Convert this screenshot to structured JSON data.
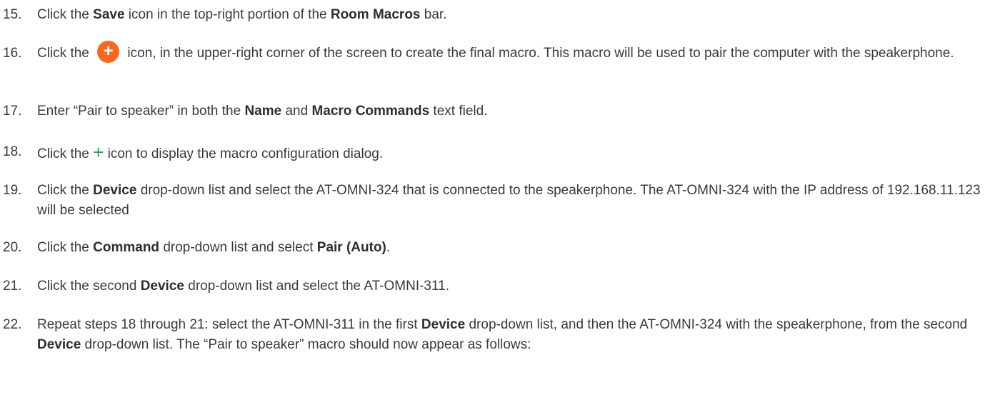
{
  "steps": [
    {
      "num": "15.",
      "parts": [
        "Click the ",
        "Save",
        " icon in the top-right portion of the ",
        "Room Macros",
        " bar."
      ]
    },
    {
      "num": "16.",
      "parts": [
        "Click the ",
        " icon, in the upper-right corner of the screen to create the final macro.  This macro will be used to pair the computer with the speakerphone."
      ],
      "icon": "orange-add-circle-icon",
      "icon_glyph": "+",
      "icon_color": "#f7681f"
    },
    {
      "num": "17.",
      "parts": [
        "Enter “Pair to speaker” in both the ",
        "Name",
        " and ",
        "Macro Commands",
        " text field."
      ]
    },
    {
      "num": "18.",
      "parts": [
        "Click the ",
        " icon to display the macro configuration dialog."
      ],
      "icon": "green-plus-icon",
      "icon_glyph": "+",
      "icon_color": "#1aa84a"
    },
    {
      "num": "19.",
      "parts": [
        "Click the ",
        "Device",
        " drop-down list and select the AT-OMNI-324 that is connected to the speakerphone.  The AT-OMNI-324 with the IP address of 192.168.11.123 will be selected"
      ]
    },
    {
      "num": "20.",
      "parts": [
        "Click the ",
        "Command",
        " drop-down list and select ",
        "Pair (Auto)",
        "."
      ]
    },
    {
      "num": "21.",
      "parts": [
        "Click the second ",
        "Device",
        " drop-down list and select the AT-OMNI-311."
      ]
    },
    {
      "num": "22.",
      "parts": [
        "Repeat steps 18 through 21:  select the AT-OMNI-311 in the first ",
        "Device",
        " drop-down list, and then the AT-OMNI-324 with the speakerphone, from the second ",
        "Device",
        " drop-down list.  The “Pair to speaker” macro should now appear as follows:"
      ]
    }
  ]
}
